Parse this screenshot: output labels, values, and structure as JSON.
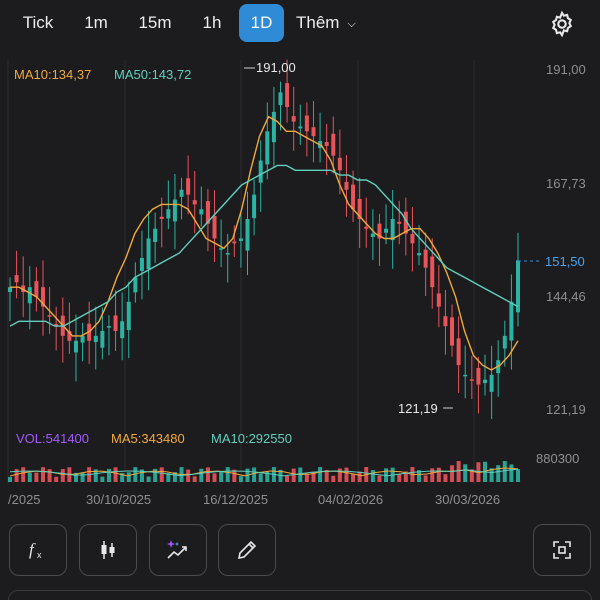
{
  "tabs": [
    {
      "label": "Tick",
      "active": false
    },
    {
      "label": "1m",
      "active": false
    },
    {
      "label": "15m",
      "active": false
    },
    {
      "label": "1h",
      "active": false
    },
    {
      "label": "1D",
      "active": true
    }
  ],
  "more_label": "Thêm",
  "icons": {
    "settings": "gear-icon",
    "more": "chevron-down-icon",
    "toolbar": [
      "function-icon",
      "candlestick-icon",
      "sparkle-chart-icon",
      "pencil-icon",
      "fullscreen-icon"
    ]
  },
  "colors": {
    "up": "#2bb3a3",
    "down": "#e9545a",
    "ma10": "#f2a93b",
    "ma50": "#5fd0bd",
    "active_tab": "#2f8bd6",
    "vol_label": "#a259ff",
    "axis_text": "#8e8e93"
  },
  "chart_data": {
    "type": "candlestick",
    "indicators": {
      "ma10_label": "MA10:134,37",
      "ma50_label": "MA50:143,72"
    },
    "y_ticks": [
      "191,00",
      "167,73",
      "151,50",
      "144,46",
      "121,19"
    ],
    "ylim": [
      121.19,
      191.0
    ],
    "last_price_label": "151,50",
    "high_label": "191,00",
    "low_label": "121,19",
    "x_labels": [
      "/2025",
      "30/10/2025",
      "16/12/2025",
      "04/02/2026",
      "30/03/2026"
    ],
    "volume": {
      "vol_label": "VOL:541400",
      "ma5_label": "MA5:343480",
      "ma10_label": "MA10:292550",
      "y_tick": "880300"
    },
    "series": [
      {
        "name": "MA10",
        "values": [
          146,
          146,
          145,
          144,
          142,
          140,
          138,
          136,
          136,
          137,
          139,
          143,
          148,
          152,
          157,
          160,
          162,
          163,
          163,
          163,
          162,
          159,
          156,
          155,
          154,
          156,
          162,
          170,
          177,
          181,
          180,
          178,
          178,
          177,
          176,
          175,
          172,
          167,
          163,
          161,
          159,
          157,
          156,
          156,
          157,
          158,
          158,
          156,
          153,
          149,
          144,
          137,
          132,
          130,
          129,
          130,
          132,
          135
        ]
      },
      {
        "name": "MA50",
        "values": [
          138,
          139,
          139,
          139,
          139,
          138,
          138,
          139,
          140,
          141,
          142,
          143,
          145,
          146,
          148,
          149,
          150,
          151,
          152,
          153,
          155,
          157,
          159,
          161,
          163,
          165,
          167,
          168,
          169,
          170,
          171,
          171,
          170,
          170,
          170,
          170,
          170,
          169,
          169,
          168,
          168,
          167,
          165,
          163,
          161,
          158,
          156,
          154,
          152,
          150,
          149,
          148,
          147,
          146,
          145,
          144,
          143,
          142
        ]
      }
    ]
  }
}
